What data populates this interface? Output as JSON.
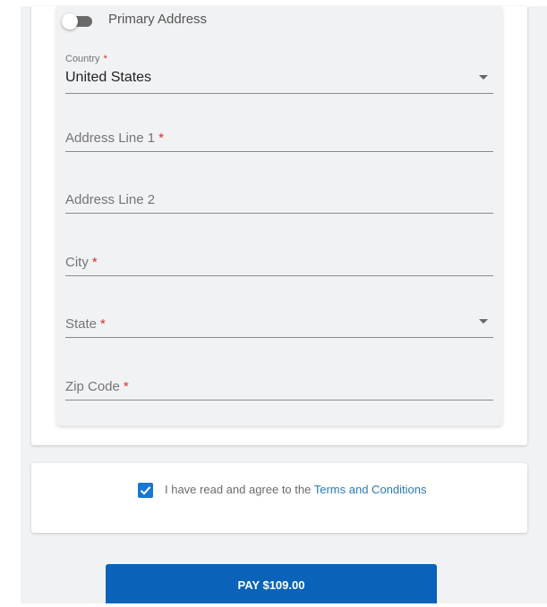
{
  "address_form": {
    "primary_toggle": {
      "label": "Primary Address",
      "checked": false
    },
    "country": {
      "label": "Country",
      "required_mark": "*",
      "value": "United States"
    },
    "address_line_1": {
      "label": "Address Line 1",
      "required_mark": "*"
    },
    "address_line_2": {
      "label": "Address Line 2"
    },
    "city": {
      "label": "City",
      "required_mark": "*"
    },
    "state": {
      "label": "State",
      "required_mark": "*"
    },
    "zip_code": {
      "label": "Zip Code",
      "required_mark": "*"
    }
  },
  "terms": {
    "checked": true,
    "text": "I have read and agree to the",
    "link_text": "Terms and Conditions"
  },
  "pay_button": {
    "label": "PAY $109.00"
  },
  "colors": {
    "accent": "#1976d2",
    "button": "#0a63b8",
    "required": "#d32f2f",
    "link": "#2a7ab8"
  }
}
